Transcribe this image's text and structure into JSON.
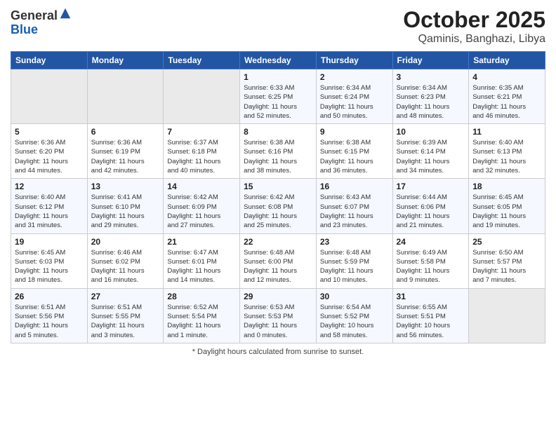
{
  "logo": {
    "general": "General",
    "blue": "Blue"
  },
  "header": {
    "month": "October 2025",
    "location": "Qaminis, Banghazi, Libya"
  },
  "weekdays": [
    "Sunday",
    "Monday",
    "Tuesday",
    "Wednesday",
    "Thursday",
    "Friday",
    "Saturday"
  ],
  "weeks": [
    [
      {
        "day": "",
        "info": ""
      },
      {
        "day": "",
        "info": ""
      },
      {
        "day": "",
        "info": ""
      },
      {
        "day": "1",
        "info": "Sunrise: 6:33 AM\nSunset: 6:25 PM\nDaylight: 11 hours\nand 52 minutes."
      },
      {
        "day": "2",
        "info": "Sunrise: 6:34 AM\nSunset: 6:24 PM\nDaylight: 11 hours\nand 50 minutes."
      },
      {
        "day": "3",
        "info": "Sunrise: 6:34 AM\nSunset: 6:23 PM\nDaylight: 11 hours\nand 48 minutes."
      },
      {
        "day": "4",
        "info": "Sunrise: 6:35 AM\nSunset: 6:21 PM\nDaylight: 11 hours\nand 46 minutes."
      }
    ],
    [
      {
        "day": "5",
        "info": "Sunrise: 6:36 AM\nSunset: 6:20 PM\nDaylight: 11 hours\nand 44 minutes."
      },
      {
        "day": "6",
        "info": "Sunrise: 6:36 AM\nSunset: 6:19 PM\nDaylight: 11 hours\nand 42 minutes."
      },
      {
        "day": "7",
        "info": "Sunrise: 6:37 AM\nSunset: 6:18 PM\nDaylight: 11 hours\nand 40 minutes."
      },
      {
        "day": "8",
        "info": "Sunrise: 6:38 AM\nSunset: 6:16 PM\nDaylight: 11 hours\nand 38 minutes."
      },
      {
        "day": "9",
        "info": "Sunrise: 6:38 AM\nSunset: 6:15 PM\nDaylight: 11 hours\nand 36 minutes."
      },
      {
        "day": "10",
        "info": "Sunrise: 6:39 AM\nSunset: 6:14 PM\nDaylight: 11 hours\nand 34 minutes."
      },
      {
        "day": "11",
        "info": "Sunrise: 6:40 AM\nSunset: 6:13 PM\nDaylight: 11 hours\nand 32 minutes."
      }
    ],
    [
      {
        "day": "12",
        "info": "Sunrise: 6:40 AM\nSunset: 6:12 PM\nDaylight: 11 hours\nand 31 minutes."
      },
      {
        "day": "13",
        "info": "Sunrise: 6:41 AM\nSunset: 6:10 PM\nDaylight: 11 hours\nand 29 minutes."
      },
      {
        "day": "14",
        "info": "Sunrise: 6:42 AM\nSunset: 6:09 PM\nDaylight: 11 hours\nand 27 minutes."
      },
      {
        "day": "15",
        "info": "Sunrise: 6:42 AM\nSunset: 6:08 PM\nDaylight: 11 hours\nand 25 minutes."
      },
      {
        "day": "16",
        "info": "Sunrise: 6:43 AM\nSunset: 6:07 PM\nDaylight: 11 hours\nand 23 minutes."
      },
      {
        "day": "17",
        "info": "Sunrise: 6:44 AM\nSunset: 6:06 PM\nDaylight: 11 hours\nand 21 minutes."
      },
      {
        "day": "18",
        "info": "Sunrise: 6:45 AM\nSunset: 6:05 PM\nDaylight: 11 hours\nand 19 minutes."
      }
    ],
    [
      {
        "day": "19",
        "info": "Sunrise: 6:45 AM\nSunset: 6:03 PM\nDaylight: 11 hours\nand 18 minutes."
      },
      {
        "day": "20",
        "info": "Sunrise: 6:46 AM\nSunset: 6:02 PM\nDaylight: 11 hours\nand 16 minutes."
      },
      {
        "day": "21",
        "info": "Sunrise: 6:47 AM\nSunset: 6:01 PM\nDaylight: 11 hours\nand 14 minutes."
      },
      {
        "day": "22",
        "info": "Sunrise: 6:48 AM\nSunset: 6:00 PM\nDaylight: 11 hours\nand 12 minutes."
      },
      {
        "day": "23",
        "info": "Sunrise: 6:48 AM\nSunset: 5:59 PM\nDaylight: 11 hours\nand 10 minutes."
      },
      {
        "day": "24",
        "info": "Sunrise: 6:49 AM\nSunset: 5:58 PM\nDaylight: 11 hours\nand 9 minutes."
      },
      {
        "day": "25",
        "info": "Sunrise: 6:50 AM\nSunset: 5:57 PM\nDaylight: 11 hours\nand 7 minutes."
      }
    ],
    [
      {
        "day": "26",
        "info": "Sunrise: 6:51 AM\nSunset: 5:56 PM\nDaylight: 11 hours\nand 5 minutes."
      },
      {
        "day": "27",
        "info": "Sunrise: 6:51 AM\nSunset: 5:55 PM\nDaylight: 11 hours\nand 3 minutes."
      },
      {
        "day": "28",
        "info": "Sunrise: 6:52 AM\nSunset: 5:54 PM\nDaylight: 11 hours\nand 1 minute."
      },
      {
        "day": "29",
        "info": "Sunrise: 6:53 AM\nSunset: 5:53 PM\nDaylight: 11 hours\nand 0 minutes."
      },
      {
        "day": "30",
        "info": "Sunrise: 6:54 AM\nSunset: 5:52 PM\nDaylight: 10 hours\nand 58 minutes."
      },
      {
        "day": "31",
        "info": "Sunrise: 6:55 AM\nSunset: 5:51 PM\nDaylight: 10 hours\nand 56 minutes."
      },
      {
        "day": "",
        "info": ""
      }
    ]
  ],
  "footer": {
    "note": "Daylight hours"
  }
}
